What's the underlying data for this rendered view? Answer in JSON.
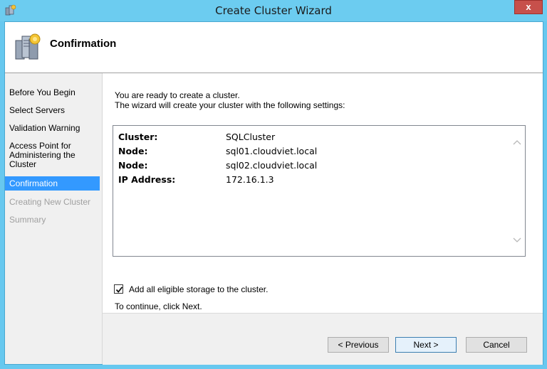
{
  "window": {
    "title": "Create Cluster Wizard",
    "close_label": "x"
  },
  "header": {
    "title": "Confirmation"
  },
  "sidebar": {
    "items": [
      {
        "label": "Before You Begin",
        "state": "normal"
      },
      {
        "label": "Select Servers",
        "state": "normal"
      },
      {
        "label": "Validation Warning",
        "state": "normal"
      },
      {
        "label": "Access Point for Administering the Cluster",
        "state": "normal"
      },
      {
        "label": "Confirmation",
        "state": "selected"
      },
      {
        "label": "Creating New Cluster",
        "state": "disabled"
      },
      {
        "label": "Summary",
        "state": "disabled"
      }
    ]
  },
  "main": {
    "intro_line1": "You are ready to create a cluster.",
    "intro_line2": "The wizard will create your cluster with the following settings:",
    "settings": [
      {
        "label": "Cluster:",
        "value": "SQLCluster"
      },
      {
        "label": "Node:",
        "value": "sql01.cloudviet.local"
      },
      {
        "label": "Node:",
        "value": "sql02.cloudviet.local"
      },
      {
        "label": "IP Address:",
        "value": "172.16.1.3"
      }
    ],
    "storage_checkbox": {
      "label": "Add all eligible storage to the cluster.",
      "checked": true
    },
    "continue_text": "To continue, click Next."
  },
  "footer": {
    "previous": "< Previous",
    "next": "Next >",
    "cancel": "Cancel"
  },
  "colors": {
    "titlebar": "#6cccf0",
    "selection": "#3399ff",
    "close": "#c7504b"
  }
}
